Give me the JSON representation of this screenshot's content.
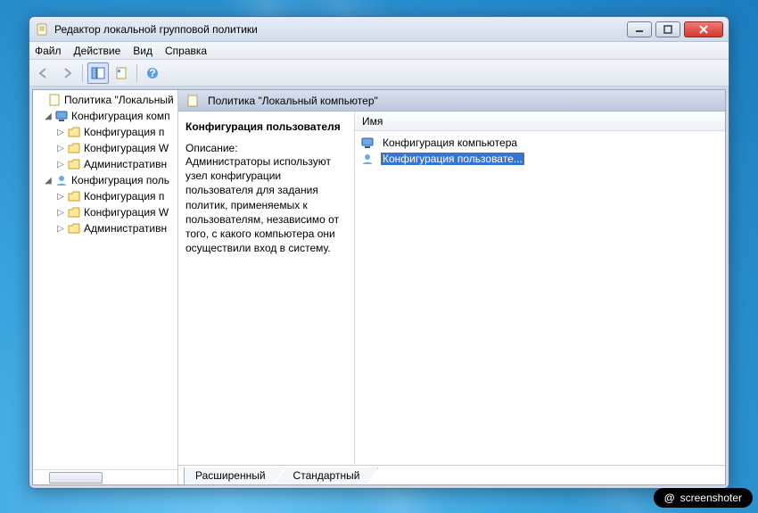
{
  "window": {
    "title": "Редактор локальной групповой политики"
  },
  "menu": {
    "file": "Файл",
    "action": "Действие",
    "view": "Вид",
    "help": "Справка"
  },
  "tree": {
    "root": "Политика \"Локальный",
    "computer_config": "Конфигурация комп",
    "comp_software": "Конфигурация п",
    "comp_windows": "Конфигурация W",
    "comp_admin": "Административн",
    "user_config": "Конфигурация поль",
    "user_software": "Конфигурация п",
    "user_windows": "Конфигурация W",
    "user_admin": "Административн"
  },
  "rightHeader": {
    "title": "Политика \"Локальный компьютер\""
  },
  "details": {
    "section_title": "Конфигурация пользователя",
    "desc_label": "Описание:",
    "desc_text": "Администраторы используют узел конфигурации пользователя для задания политик, применяемых к пользователям, независимо от того, с какого компьютера они осуществили вход в систему."
  },
  "list": {
    "column_name": "Имя",
    "items": [
      "Конфигурация компьютера",
      "Конфигурация пользовате..."
    ]
  },
  "tabs": {
    "extended": "Расширенный",
    "standard": "Стандартный"
  },
  "watermark": "screenshoter"
}
